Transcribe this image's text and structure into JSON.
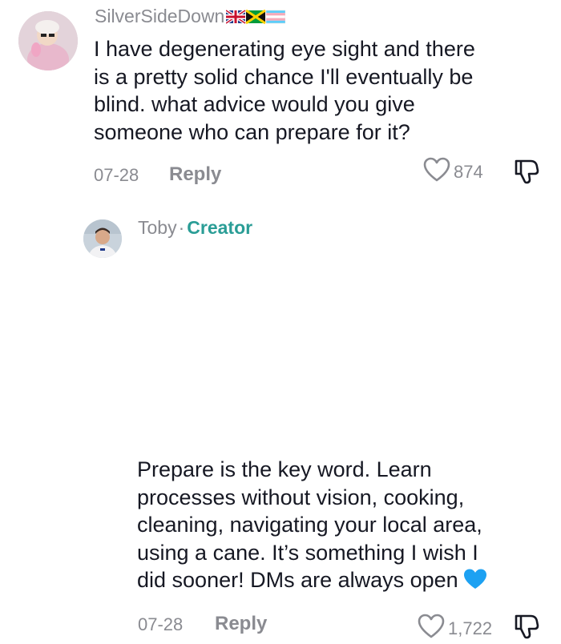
{
  "comments": [
    {
      "username": "SilverSideDown",
      "flags": [
        "uk-flag",
        "jamaica-flag",
        "trans-flag"
      ],
      "text": "I have degenerating eye sight and there\nis a pretty solid chance I'll eventually be\nblind. what advice would you give\nsomeone who can prepare for it?",
      "date": "07-28",
      "reply_label": "Reply",
      "likes": "874"
    },
    {
      "username": "Toby",
      "separator": "·",
      "badge": "Creator",
      "text": "Prepare is the key word. Learn\nprocesses without vision, cooking,\ncleaning, navigating your local area,\nusing a cane. It’s something I wish I\ndid sooner! DMs are always open",
      "emoji": "blue-heart",
      "date": "07-28",
      "reply_label": "Reply",
      "likes": "1,722"
    }
  ],
  "colors": {
    "muted": "#8a8b91",
    "text": "#161823",
    "creator": "#2a9d96",
    "blue_heart": "#1da1f2"
  }
}
